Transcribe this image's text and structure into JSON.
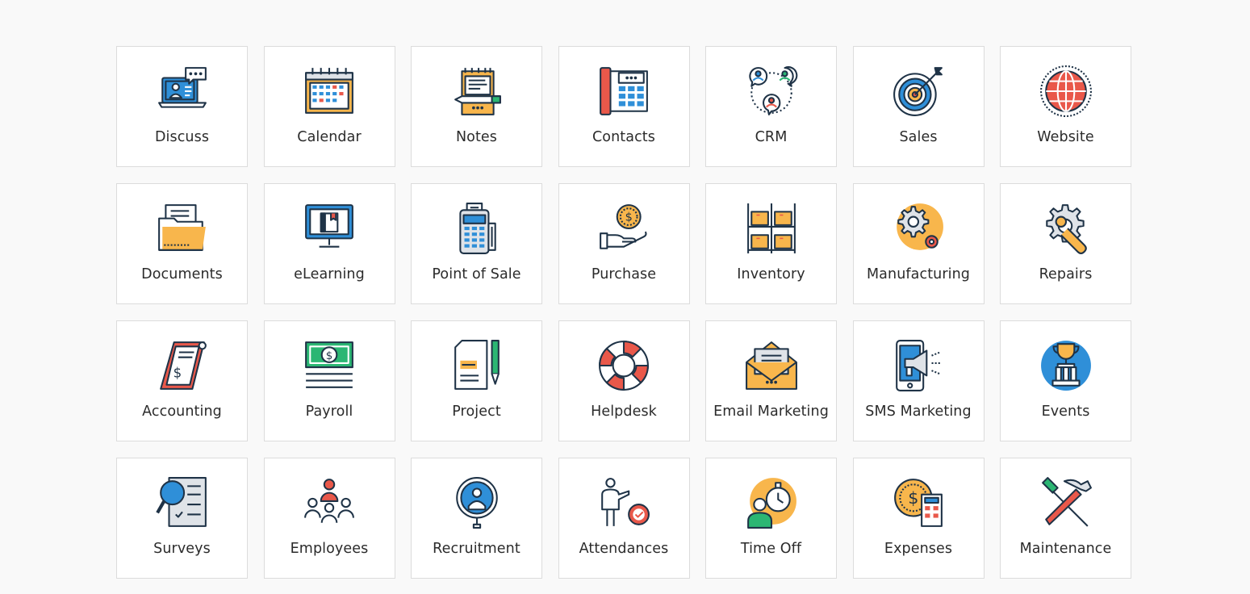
{
  "apps": [
    {
      "name": "Discuss",
      "icon": "discuss-icon"
    },
    {
      "name": "Calendar",
      "icon": "calendar-icon"
    },
    {
      "name": "Notes",
      "icon": "notes-icon"
    },
    {
      "name": "Contacts",
      "icon": "contacts-icon"
    },
    {
      "name": "CRM",
      "icon": "crm-icon"
    },
    {
      "name": "Sales",
      "icon": "sales-icon"
    },
    {
      "name": "Website",
      "icon": "website-icon"
    },
    {
      "name": "Documents",
      "icon": "documents-icon"
    },
    {
      "name": "eLearning",
      "icon": "elearning-icon"
    },
    {
      "name": "Point of Sale",
      "icon": "point-of-sale-icon"
    },
    {
      "name": "Purchase",
      "icon": "purchase-icon"
    },
    {
      "name": "Inventory",
      "icon": "inventory-icon"
    },
    {
      "name": "Manufacturing",
      "icon": "manufacturing-icon"
    },
    {
      "name": "Repairs",
      "icon": "repairs-icon"
    },
    {
      "name": "Accounting",
      "icon": "accounting-icon"
    },
    {
      "name": "Payroll",
      "icon": "payroll-icon"
    },
    {
      "name": "Project",
      "icon": "project-icon"
    },
    {
      "name": "Helpdesk",
      "icon": "helpdesk-icon"
    },
    {
      "name": "Email Marketing",
      "icon": "email-marketing-icon"
    },
    {
      "name": "SMS Marketing",
      "icon": "sms-marketing-icon"
    },
    {
      "name": "Events",
      "icon": "events-icon"
    },
    {
      "name": "Surveys",
      "icon": "surveys-icon"
    },
    {
      "name": "Employees",
      "icon": "employees-icon"
    },
    {
      "name": "Recruitment",
      "icon": "recruitment-icon"
    },
    {
      "name": "Attendances",
      "icon": "attendances-icon"
    },
    {
      "name": "Time Off",
      "icon": "time-off-icon"
    },
    {
      "name": "Expenses",
      "icon": "expenses-icon"
    },
    {
      "name": "Maintenance",
      "icon": "maintenance-icon"
    }
  ],
  "colors": {
    "background": "#f9f9f9",
    "tile": "#ffffff",
    "tile_border": "#dcdcdc",
    "icon_outline": "#1f3347",
    "icon_blue": "#2f8fd8",
    "icon_orange": "#f8b64c",
    "icon_red": "#e9584a",
    "icon_green": "#2bb673",
    "label_text": "#2b2b2b"
  }
}
